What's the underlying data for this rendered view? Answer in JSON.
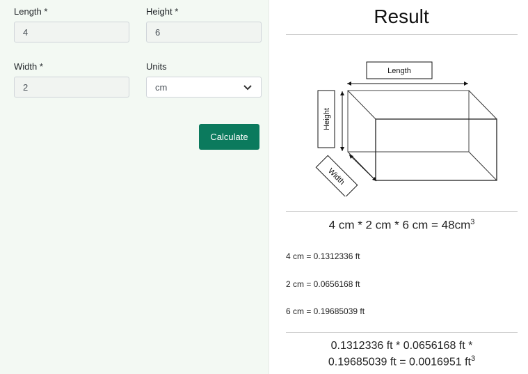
{
  "form": {
    "length_label": "Length *",
    "length_value": "4",
    "height_label": "Height *",
    "height_value": "6",
    "width_label": "Width *",
    "width_value": "2",
    "units_label": "Units",
    "units_value": "cm",
    "calculate_label": "Calculate"
  },
  "result": {
    "title": "Result",
    "diagram_labels": {
      "length": "Length",
      "height": "Height",
      "width": "Width"
    },
    "main_equation": "4 cm * 2 cm * 6 cm = 48cm",
    "main_equation_exp": "3",
    "conversions": [
      "4 cm = 0.1312336 ft",
      "2 cm = 0.0656168 ft",
      "6 cm = 0.19685039 ft"
    ],
    "final_line1": "0.1312336 ft * 0.0656168 ft *",
    "final_line2": "0.19685039 ft = 0.0016951 ft",
    "final_exp": "3"
  },
  "colors": {
    "left_bg": "#f3f9f3",
    "button": "#0b7a5d"
  }
}
